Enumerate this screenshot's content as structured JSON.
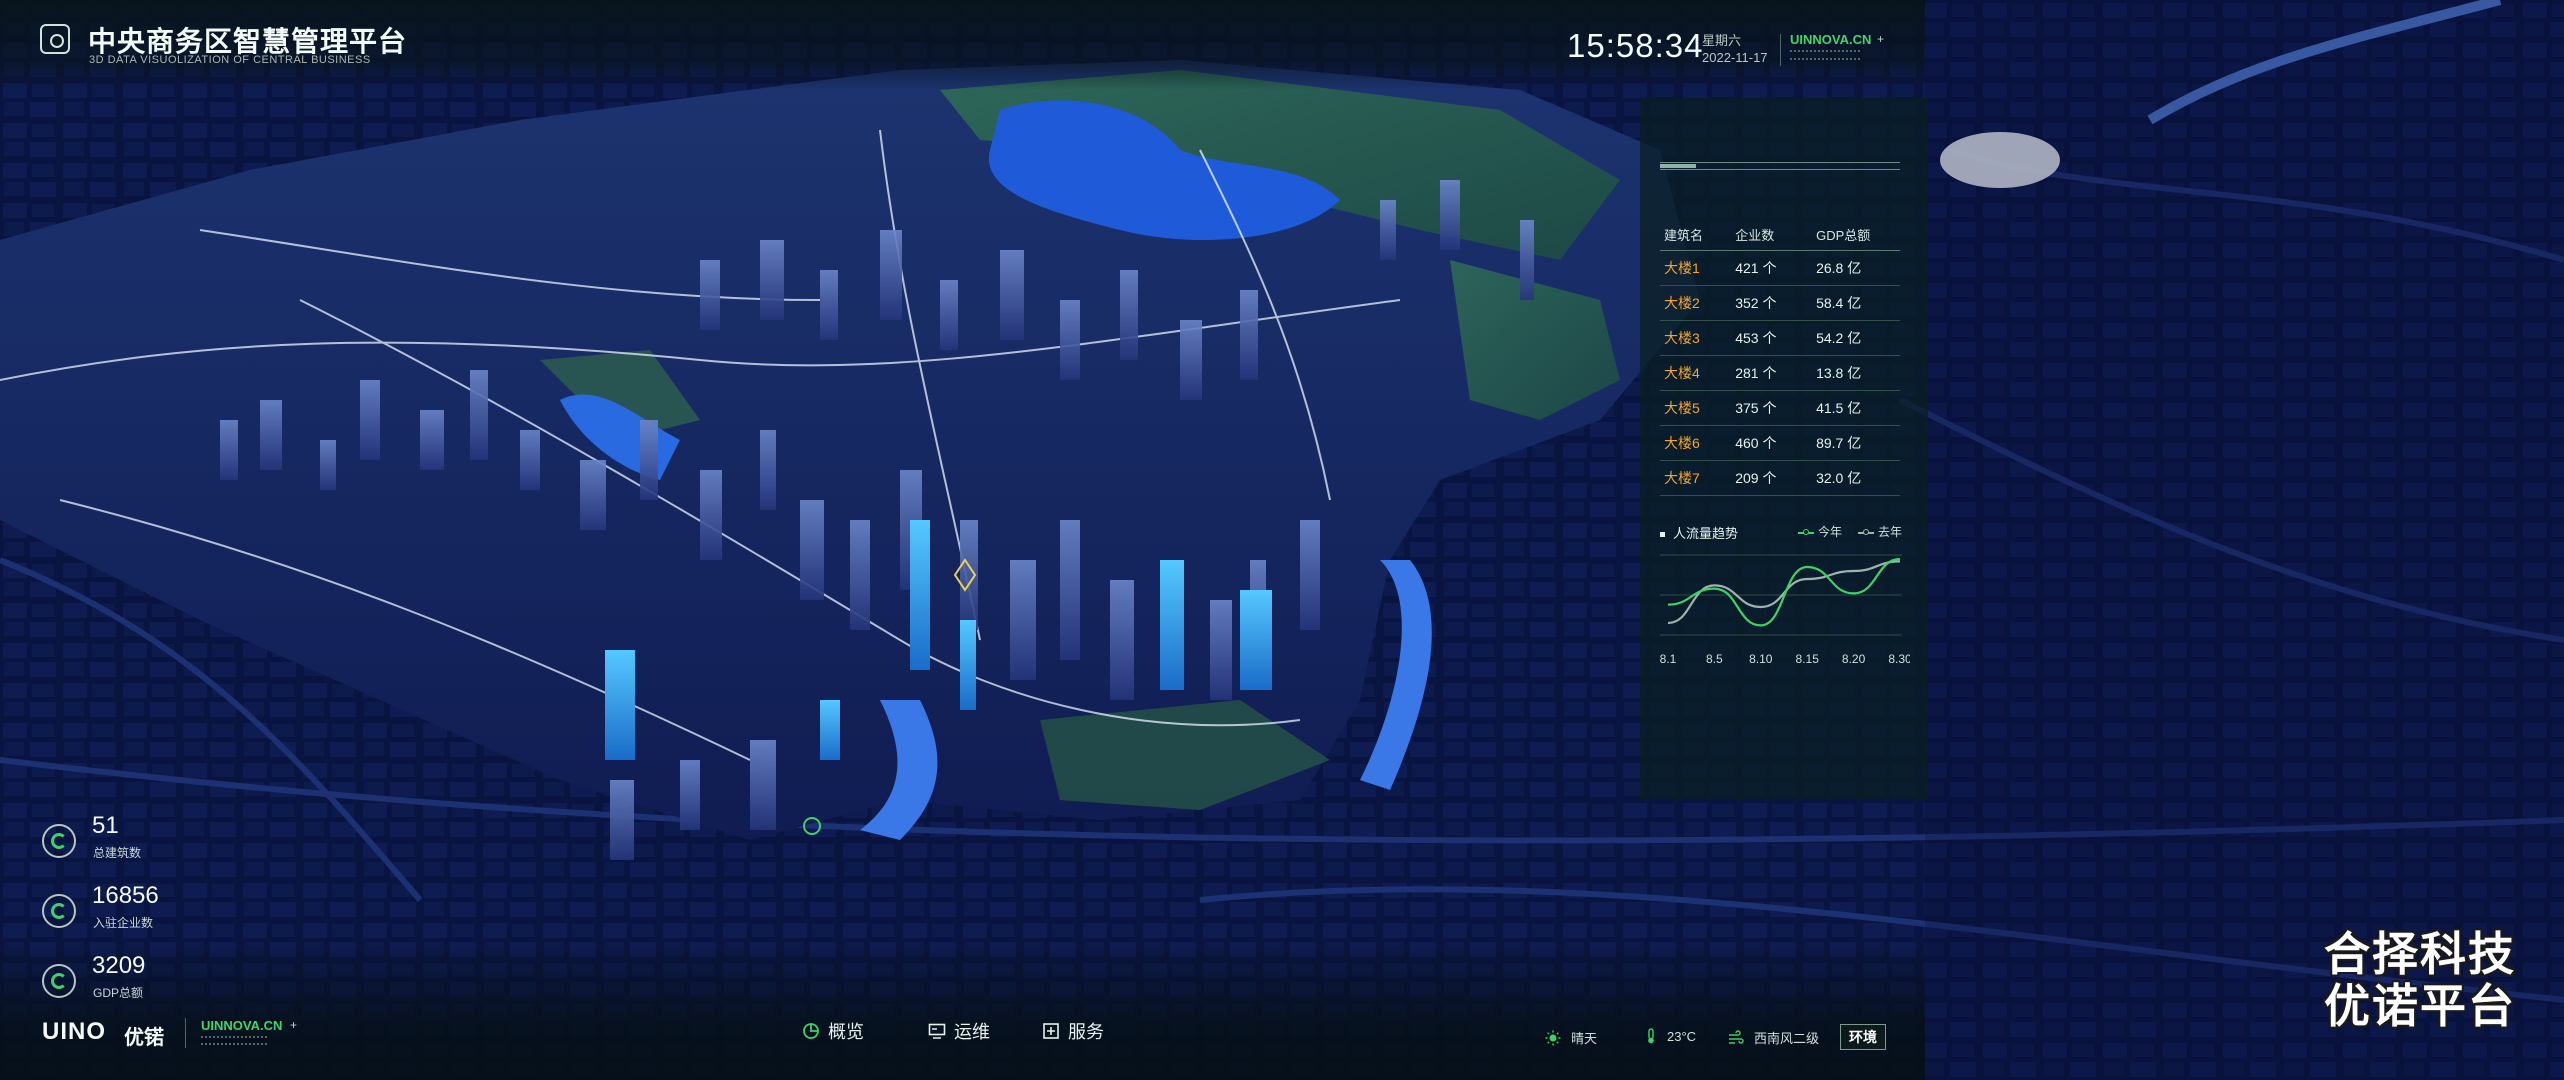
{
  "header": {
    "title": "中央商务区智慧管理平台",
    "subtitle": "3D DATA VISUOLIZATION OF CENTRAL BUSINESS",
    "time": "15:58:34",
    "weekday": "星期六",
    "date": "2022-11-17",
    "brand": "UINNOVA.CN"
  },
  "building_table": {
    "columns": [
      "建筑名",
      "企业数",
      "GDP总额"
    ],
    "rows": [
      {
        "name": "大楼1",
        "companies": "421 个",
        "gdp": "26.8 亿"
      },
      {
        "name": "大楼2",
        "companies": "352 个",
        "gdp": "58.4 亿"
      },
      {
        "name": "大楼3",
        "companies": "453 个",
        "gdp": "54.2 亿"
      },
      {
        "name": "大楼4",
        "companies": "281 个",
        "gdp": "13.8 亿"
      },
      {
        "name": "大楼5",
        "companies": "375 个",
        "gdp": "41.5 亿"
      },
      {
        "name": "大楼6",
        "companies": "460 个",
        "gdp": "89.7 亿"
      },
      {
        "name": "大楼7",
        "companies": "209 个",
        "gdp": "32.0 亿"
      }
    ]
  },
  "trend": {
    "title": "人流量趋势",
    "legend_this_year": "今年",
    "legend_last_year": "去年",
    "color_this_year": "#3cd267",
    "color_last_year": "#9fb3ad",
    "x_labels": [
      "8.1",
      "8.5",
      "8.10",
      "8.15",
      "8.20",
      "8.30"
    ],
    "this_year": [
      0.38,
      0.58,
      0.12,
      0.85,
      0.52,
      0.95
    ],
    "last_year": [
      0.15,
      0.62,
      0.35,
      0.7,
      0.8,
      0.92
    ]
  },
  "stats": [
    {
      "value": "51",
      "label": "总建筑数"
    },
    {
      "value": "16856",
      "label": "入驻企业数"
    },
    {
      "value": "3209",
      "label": "GDP总额"
    }
  ],
  "footer": {
    "logo_text": "UINO",
    "logo_cn": "优锘",
    "brand": "UINNOVA.CN",
    "nav": [
      {
        "label": "概览",
        "icon": "pie-chart-icon"
      },
      {
        "label": "运维",
        "icon": "monitor-icon"
      },
      {
        "label": "服务",
        "icon": "plus-square-icon"
      }
    ],
    "weather": {
      "condition": "晴天",
      "temperature": "23°C",
      "wind": "西南风二级"
    },
    "env_button": "环境"
  },
  "watermark": [
    "合择科技",
    "优诺平台"
  ],
  "colors": {
    "accent": "#3cd267",
    "building_name": "#f0a630",
    "map_background": "#060d2a"
  }
}
